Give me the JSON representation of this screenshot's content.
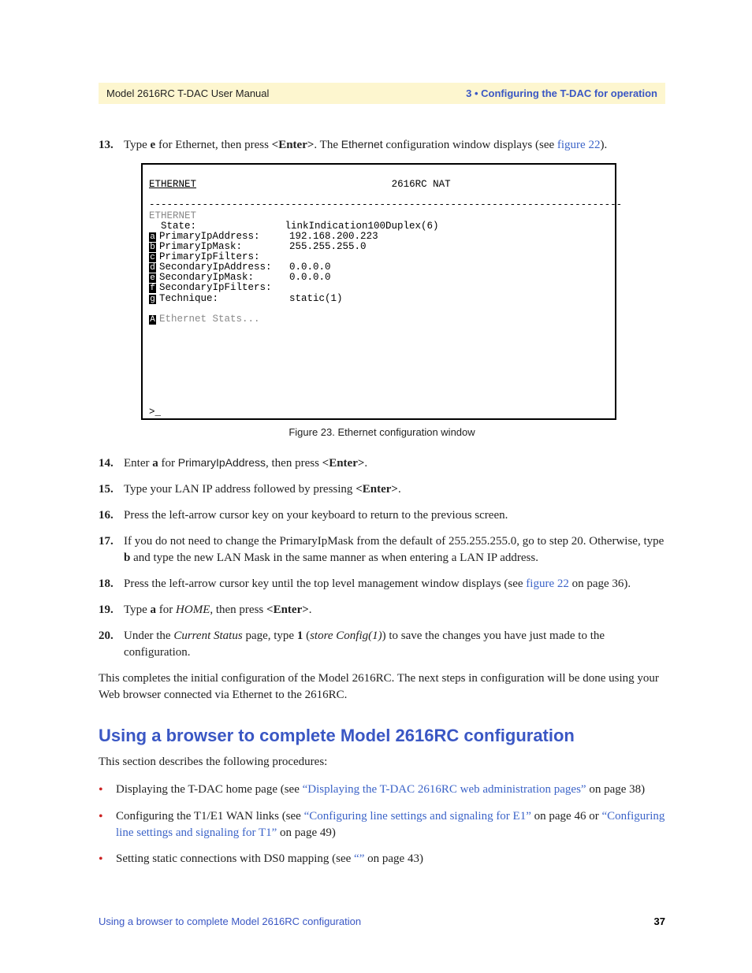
{
  "header": {
    "left": "Model 2616RC T-DAC User Manual",
    "right": "3 • Configuring the T-DAC for operation"
  },
  "step13": {
    "num": "13.",
    "t1": "Type ",
    "e": "e",
    "t2": " for Ethernet, then press ",
    "enter": "<Enter>",
    "t3": ". The ",
    "eth": "Ethernet",
    "t4": " configuration window displays (see ",
    "link": "figure 22",
    "t5": ")."
  },
  "terminal": {
    "title_left": "ETHERNET",
    "title_right": "2616RC NAT",
    "dashline": "--------------------------------------------------------------------------------",
    "eth_label": "ETHERNET",
    "rows": [
      {
        "tag": "",
        "label": "  State:",
        "value": "linkIndication100Duplex(6)"
      },
      {
        "tag": "a",
        "label": "PrimaryIpAddress:",
        "value": "192.168.200.223"
      },
      {
        "tag": "b",
        "label": "PrimaryIpMask:",
        "value": "255.255.255.0"
      },
      {
        "tag": "c",
        "label": "PrimaryIpFilters:",
        "value": ""
      },
      {
        "tag": "d",
        "label": "SecondaryIpAddress:",
        "value": "0.0.0.0"
      },
      {
        "tag": "e",
        "label": "SecondaryIpMask:",
        "value": "0.0.0.0"
      },
      {
        "tag": "f",
        "label": "SecondaryIpFilters:",
        "value": ""
      },
      {
        "tag": "g",
        "label": "Technique:",
        "value": "static(1)"
      }
    ],
    "stats_tag": "A",
    "stats_label": "Ethernet Stats...",
    "prompt": ">_"
  },
  "fig_caption": "Figure 23. Ethernet configuration window",
  "step14": {
    "num": "14.",
    "t1": "Enter ",
    "a": "a",
    "t2": " for ",
    "pia": "PrimaryIpAddress",
    "t3": ", then press ",
    "enter": "<Enter>",
    "t4": "."
  },
  "step15": {
    "num": "15.",
    "t1": "Type your LAN IP address followed by pressing ",
    "enter": "<Enter>",
    "t2": "."
  },
  "step16": {
    "num": "16.",
    "t1": "Press the left-arrow cursor key on your keyboard to return to the previous screen."
  },
  "step17": {
    "num": "17.",
    "t1": "If you do not need to change the PrimaryIpMask from the default of 255.255.255.0, go to step 20. Otherwise, type ",
    "b": "b",
    "t2": " and type the new LAN Mask in the same manner as when entering a LAN IP address."
  },
  "step18": {
    "num": "18.",
    "t1": "Press the left-arrow cursor key until the top level management window displays (see ",
    "link": "figure 22",
    "t2": " on page 36)."
  },
  "step19": {
    "num": "19.",
    "t1": "Type ",
    "a": "a",
    "t2": " for ",
    "home": "HOME",
    "t3": ", then press ",
    "enter": "<Enter>",
    "t4": "."
  },
  "step20": {
    "num": "20.",
    "t1": "Under the ",
    "cs": "Current Status",
    "t2": " page, type ",
    "one": "1",
    "t3": " (",
    "sc": "store Config(1)",
    "t4": ") to save the changes you have just made to the configuration."
  },
  "closing": "This completes the initial configuration of the Model 2616RC. The next steps in configuration will be done using your Web browser connected via Ethernet to the 2616RC.",
  "h2": "Using a browser to complete Model 2616RC configuration",
  "intro": "This section describes the following procedures:",
  "bul1": {
    "t1": "Displaying the T-DAC home page (see ",
    "link": "“Displaying the T-DAC 2616RC web administration pages”",
    "t2": " on page 38)"
  },
  "bul2": {
    "t1": "Configuring the T1/E1 WAN links (see ",
    "link1": "“Configuring line settings and signaling for E1”",
    "t2": " on page 46 or ",
    "link2": "“Configuring line settings and signaling for T1”",
    "t3": " on page 49)"
  },
  "bul3": {
    "t1": "Setting static connections with DS0 mapping (see ",
    "link": "“”",
    "t2": " on page 43)"
  },
  "footer": {
    "left": "Using a browser to complete Model 2616RC configuration",
    "right": "37"
  }
}
